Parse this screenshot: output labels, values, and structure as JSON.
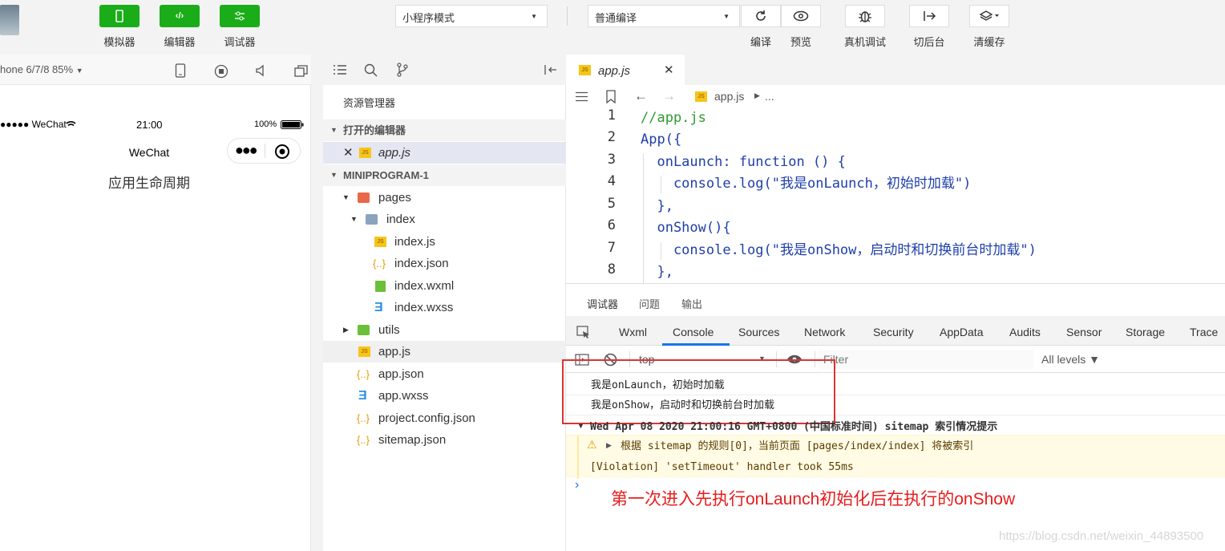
{
  "toolbar": {
    "left_buttons": [
      {
        "label": "模拟器",
        "icon": "phone-icon"
      },
      {
        "label": "编辑器",
        "icon": "code-icon"
      },
      {
        "label": "调试器",
        "icon": "sliders-icon"
      }
    ],
    "mode_select": "小程序模式",
    "compile_select": "普通编译",
    "right_buttons": [
      {
        "label": "编译",
        "icon": "refresh-icon"
      },
      {
        "label": "预览",
        "icon": "eye-icon"
      },
      {
        "label": "真机调试",
        "icon": "bug-icon"
      },
      {
        "label": "切后台",
        "icon": "switch-background-icon"
      },
      {
        "label": "清缓存",
        "icon": "layers-icon"
      }
    ],
    "accent": "#1aad19"
  },
  "simulator": {
    "device": "hone 6/7/8 85%",
    "status_carrier": "●●●●● WeChat",
    "status_time": "21:00",
    "status_battery": "100%",
    "nav_title": "WeChat",
    "page_text": "应用生命周期"
  },
  "explorer": {
    "title": "资源管理器",
    "open_editors_label": "打开的编辑器",
    "open_file": "app.js",
    "project_label": "MINIPROGRAM-1",
    "tree": [
      {
        "label": "pages",
        "type": "folder-open"
      },
      {
        "label": "index",
        "type": "folder-open"
      },
      {
        "label": "index.js",
        "type": "js"
      },
      {
        "label": "index.json",
        "type": "json"
      },
      {
        "label": "index.wxml",
        "type": "wxml"
      },
      {
        "label": "index.wxss",
        "type": "css"
      },
      {
        "label": "utils",
        "type": "folder"
      },
      {
        "label": "app.js",
        "type": "js"
      },
      {
        "label": "app.json",
        "type": "json"
      },
      {
        "label": "app.wxss",
        "type": "css"
      },
      {
        "label": "project.config.json",
        "type": "json"
      },
      {
        "label": "sitemap.json",
        "type": "json"
      }
    ]
  },
  "editor": {
    "tab_label": "app.js",
    "breadcrumb_file": "app.js",
    "breadcrumb_more": "...",
    "line_numbers": [
      "1",
      "2",
      "3",
      "4",
      "5",
      "6",
      "7",
      "8"
    ],
    "code": [
      {
        "t": "//app.js"
      },
      {
        "t": "App({"
      },
      {
        "t": "  onLaunch: function () {"
      },
      {
        "t": "    console.log(\"我是onLaunch，初始时加载\")"
      },
      {
        "t": "  },"
      },
      {
        "t": "  onShow(){"
      },
      {
        "t": "    console.log(\"我是onShow，启动时和切换前台时加载\")"
      },
      {
        "t": "  },"
      }
    ]
  },
  "debugger": {
    "top_tabs": [
      "调试器",
      "问题",
      "输出"
    ],
    "tabs": [
      "Wxml",
      "Console",
      "Sources",
      "Network",
      "Security",
      "AppData",
      "Audits",
      "Sensor",
      "Storage",
      "Trace"
    ],
    "active_tab": "Console",
    "context_select": "top",
    "filter_placeholder": "Filter",
    "levels": "All levels ▼",
    "logs": [
      "我是onLaunch，初始时加载",
      "我是onShow，启动时和切换前台时加载"
    ],
    "sitemap_header": "Wed Apr 08 2020 21:00:16 GMT+0800 (中国标准时间) sitemap 索引情况提示",
    "warning": "根据 sitemap 的规则[0]，当前页面 [pages/index/index] 将被索引",
    "violation": "[Violation] 'setTimeout' handler took 55ms",
    "annotation": "第一次进入先执行onLaunch初始化后在执行的onShow",
    "watermark": "https://blog.csdn.net/weixin_44893500"
  }
}
